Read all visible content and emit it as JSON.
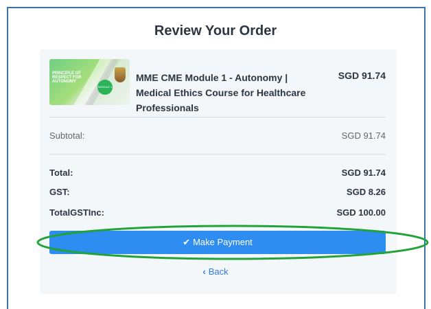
{
  "page": {
    "title": "Review Your Order"
  },
  "product": {
    "thumbnail_heading": "PRINCIPLE OF RESPECT FOR AUTONOMY",
    "thumbnail_badge": "MODULE 1",
    "name": "MME CME Module 1 - Autonomy | Medical Ethics Course for Healthcare Professionals",
    "price": "SGD 91.74"
  },
  "summary": {
    "subtotal_label": "Subtotal:",
    "subtotal_value": "SGD 91.74",
    "total_label": "Total:",
    "total_value": "SGD 91.74",
    "gst_label": "GST:",
    "gst_value": "SGD 8.26",
    "total_gst_inc_label": "TotalGSTInc:",
    "total_gst_inc_value": "SGD 100.00"
  },
  "actions": {
    "pay_label": "Make Payment",
    "pay_icon": "check-icon",
    "back_label": "Back",
    "back_icon": "chevron-left-icon"
  },
  "colors": {
    "primary_button": "#2f8cf0",
    "link": "#2f7ce0",
    "highlight_ellipse": "#21a33a",
    "panel_background": "#f4f7fa"
  }
}
